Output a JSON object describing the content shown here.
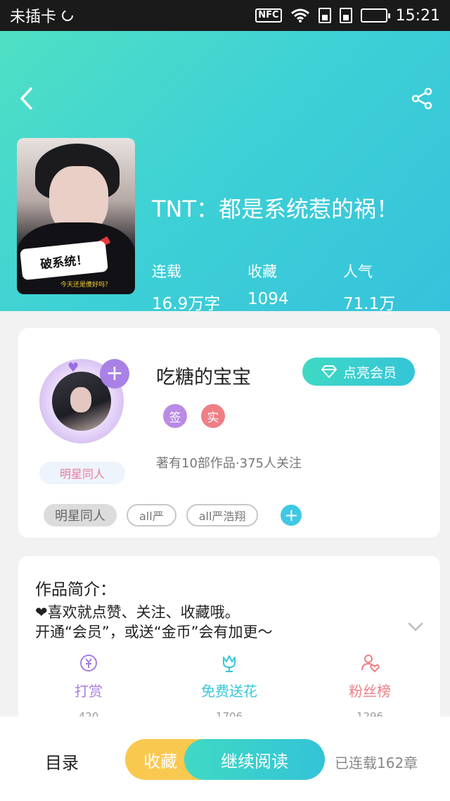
{
  "status_bar": {
    "carrier": "未插卡",
    "nfc": "NFC",
    "time": "15:21"
  },
  "book": {
    "title": "TNT：都是系统惹的祸！",
    "cover_bubble": "破系统！",
    "cover_caption": "今天还是傻好吗？",
    "stats": [
      {
        "label": "连载",
        "value": "16.9万字"
      },
      {
        "label": "收藏",
        "value": "1094"
      },
      {
        "label": "人气",
        "value": "71.1万"
      }
    ]
  },
  "author": {
    "name": "吃糖的宝宝",
    "vip_label": "点亮会员",
    "badge_sign": "签",
    "badge_real": "实",
    "stats_text": "著有10部作品·375人关注",
    "avatar_tag": "明星同人",
    "add_symbol": "+"
  },
  "tags": [
    "明星同人",
    "all严",
    "all严浩翔"
  ],
  "intro": {
    "title": "作品简介：",
    "line1": "❤喜欢就点赞、关注、收藏哦。",
    "line2": "开通“会员”，或送“金币”会有加更～"
  },
  "actions": [
    {
      "label": "打赏",
      "count": "420",
      "color": "#a67ee0"
    },
    {
      "label": "免费送花",
      "count": "1706",
      "color": "#38c6d8"
    },
    {
      "label": "粉丝榜",
      "count": "1296",
      "color": "#ef7e85"
    }
  ],
  "bottom": {
    "toc_label": "目录",
    "fav_label": "收藏",
    "read_label": "继续阅读",
    "chapters_text": "已连载162章"
  },
  "colors": {
    "accent": "#3dd0d6",
    "vip": "#a981e6",
    "gold": "#f9c84f"
  }
}
